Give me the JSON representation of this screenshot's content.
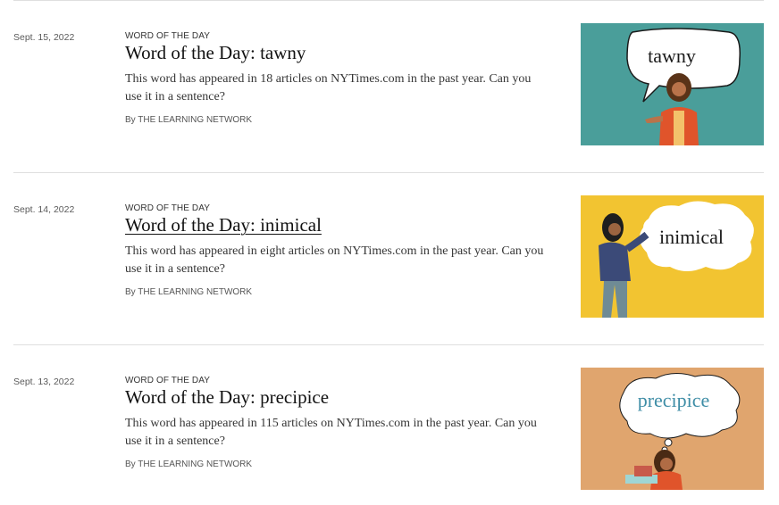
{
  "articles": [
    {
      "date": "Sept. 15, 2022",
      "kicker": "WORD OF THE DAY",
      "headline": "Word of the Day: tawny",
      "summary": "This word has appeared in 18 articles on NYTimes.com in the past year. Can you use it in a sentence?",
      "by": "By",
      "author": "THE LEARNING NETWORK",
      "thumb_word": "tawny",
      "thumb_bg": "#4a9e9a"
    },
    {
      "date": "Sept. 14, 2022",
      "kicker": "WORD OF THE DAY",
      "headline": "Word of the Day: inimical",
      "summary": "This word has appeared in eight articles on NYTimes.com in the past year. Can you use it in a sentence?",
      "by": "By",
      "author": "THE LEARNING NETWORK",
      "thumb_word": "inimical",
      "thumb_bg": "#f2c431"
    },
    {
      "date": "Sept. 13, 2022",
      "kicker": "WORD OF THE DAY",
      "headline": "Word of the Day: precipice",
      "summary": "This word has appeared in 115 articles on NYTimes.com in the past year. Can you use it in a sentence?",
      "by": "By",
      "author": "THE LEARNING NETWORK",
      "thumb_word": "precipice",
      "thumb_bg": "#e0a56e"
    }
  ]
}
